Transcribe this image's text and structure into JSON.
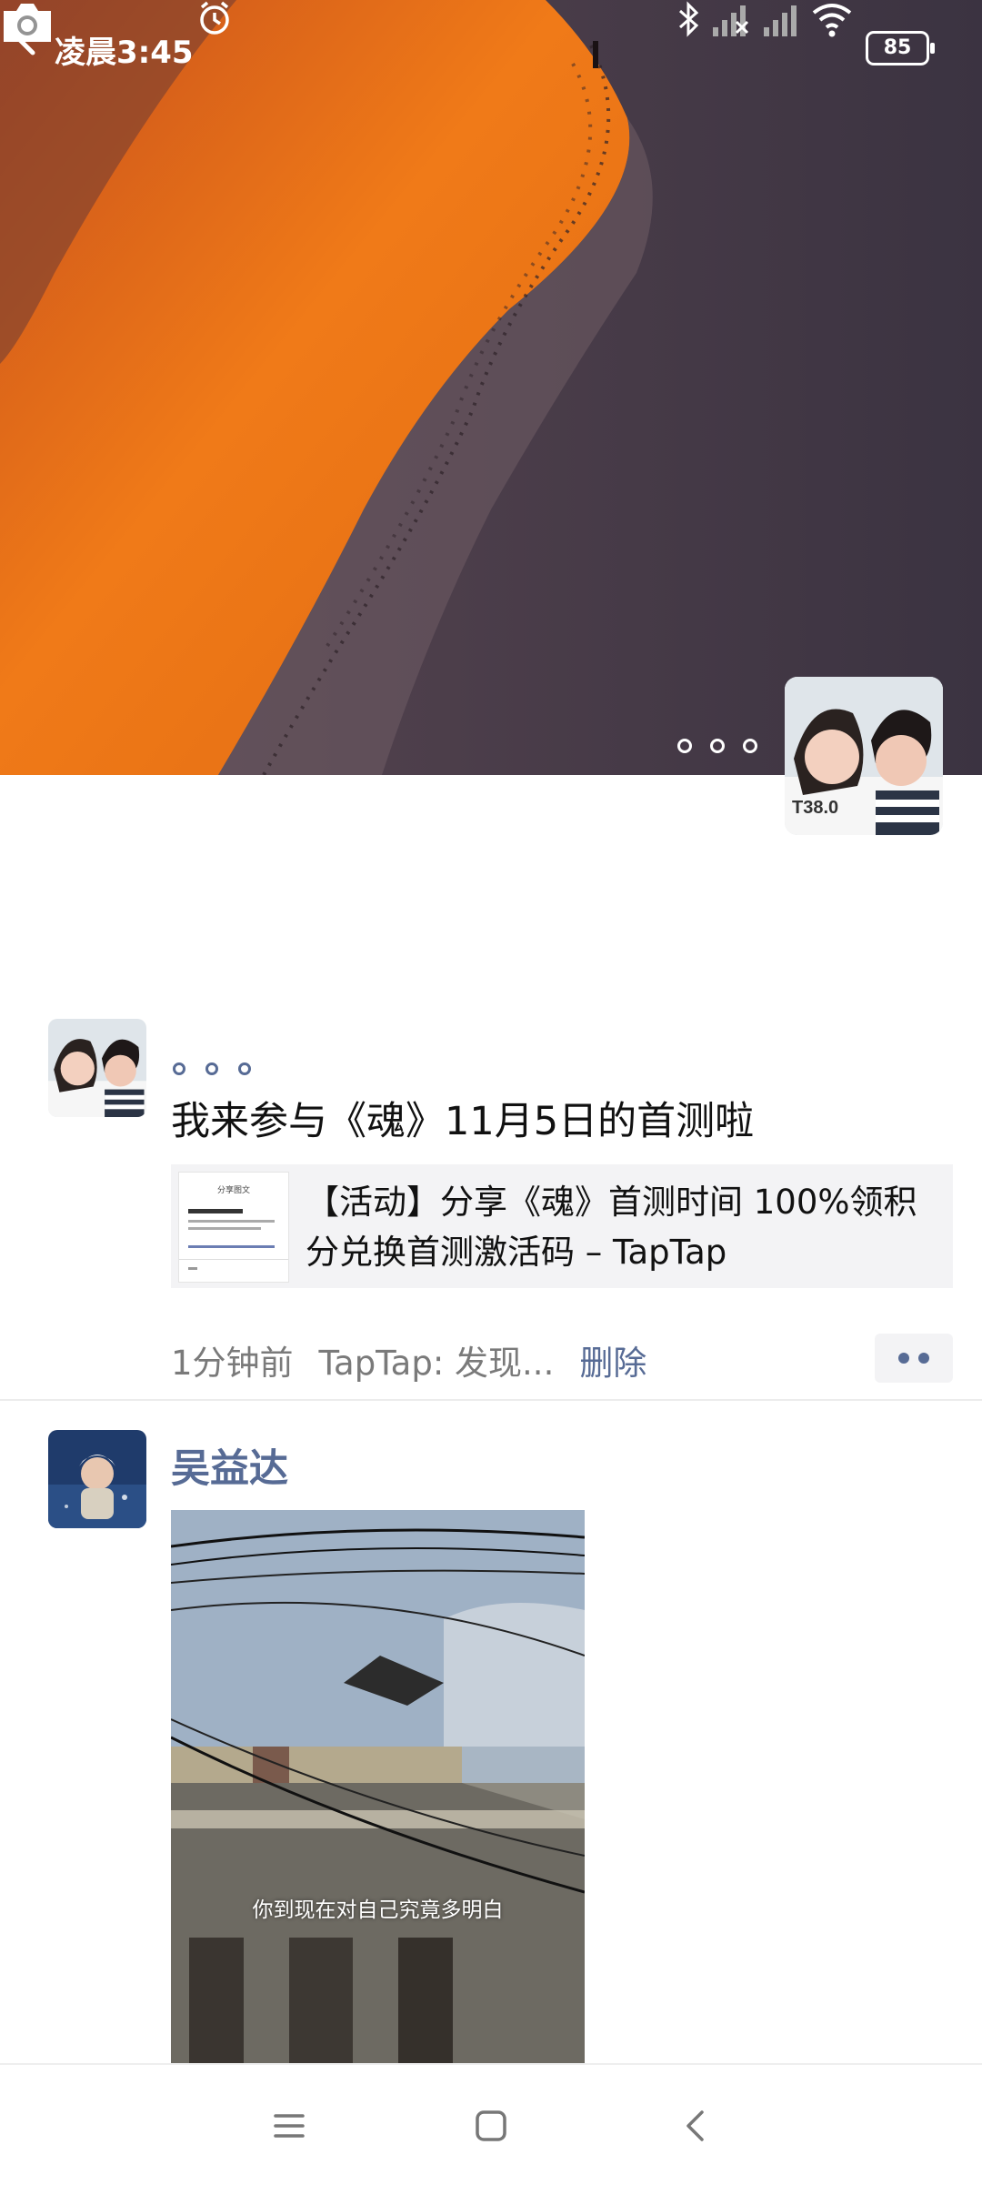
{
  "status_bar": {
    "time": "凌晨3:45",
    "battery": "85",
    "icons": [
      "alarm-icon",
      "bluetooth-icon",
      "signal-icon",
      "signal-icon",
      "wifi-icon",
      "battery-icon"
    ]
  },
  "header": {
    "back_icon": "chevron-left-icon",
    "camera_icon": "camera-icon"
  },
  "posts": [
    {
      "text": "我来参与《魂》11月5日的首测啦",
      "link": {
        "title": "【活动】分享《魂》首测时间 100%领积分兑换首测激活码 – TapTap",
        "thumb_heading": "分享图文"
      },
      "time": "1分钟前",
      "source": "TapTap: 发现...",
      "delete": "删除"
    },
    {
      "username": "吴益达",
      "video_caption": "你到现在对自己究竟多明白"
    }
  ],
  "colors": {
    "link_blue": "#576b95",
    "card_bg": "#f3f3f5"
  }
}
